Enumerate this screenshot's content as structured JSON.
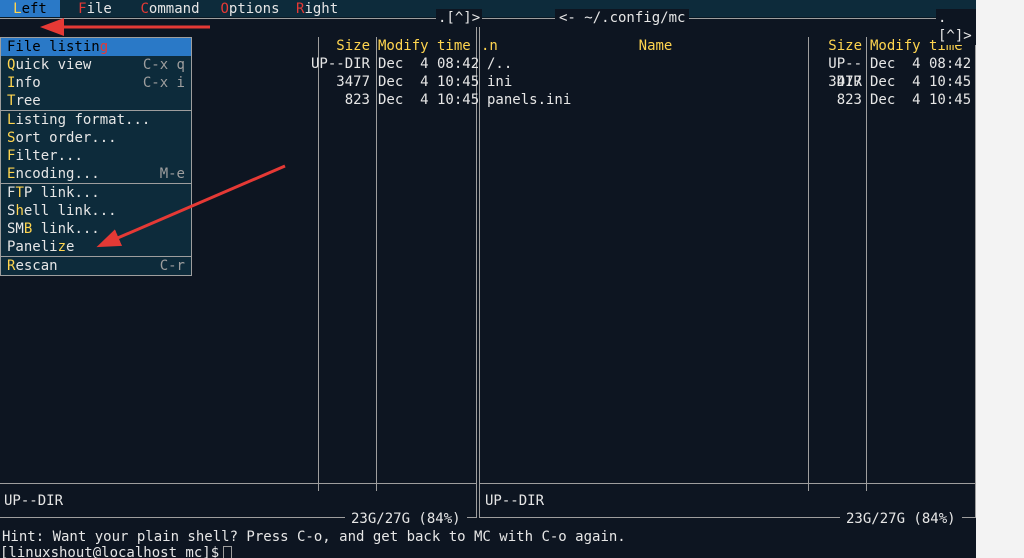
{
  "menubar": {
    "left": {
      "hot": "L",
      "rest": "eft"
    },
    "file": {
      "hot": "F",
      "rest": "ile"
    },
    "command": {
      "hot": "C",
      "rest": "ommand"
    },
    "options": {
      "hot": "O",
      "rest": "ptions"
    },
    "right": {
      "hot": "R",
      "rest": "ight"
    }
  },
  "dropdown": {
    "groups": [
      [
        {
          "label_pre": "File listin",
          "hot": "g",
          "label_post": "",
          "shortcut": "",
          "active": true
        },
        {
          "label_pre": "",
          "hot": "Q",
          "label_post": "uick view",
          "shortcut": "C-x q",
          "active": false
        },
        {
          "label_pre": "",
          "hot": "I",
          "label_post": "nfo",
          "shortcut": "C-x i",
          "active": false
        },
        {
          "label_pre": "",
          "hot": "T",
          "label_post": "ree",
          "shortcut": "",
          "active": false
        }
      ],
      [
        {
          "label_pre": "",
          "hot": "L",
          "label_post": "isting format...",
          "shortcut": "",
          "active": false
        },
        {
          "label_pre": "",
          "hot": "S",
          "label_post": "ort order...",
          "shortcut": "",
          "active": false
        },
        {
          "label_pre": "",
          "hot": "F",
          "label_post": "ilter...",
          "shortcut": "",
          "active": false
        },
        {
          "label_pre": "",
          "hot": "E",
          "label_post": "ncoding...",
          "shortcut": "M-e",
          "active": false
        }
      ],
      [
        {
          "label_pre": "F",
          "hot": "T",
          "label_post": "P link...",
          "shortcut": "",
          "active": false
        },
        {
          "label_pre": "S",
          "hot": "h",
          "label_post": "ell link...",
          "shortcut": "",
          "active": false
        },
        {
          "label_pre": "SM",
          "hot": "B",
          "label_post": " link...",
          "shortcut": "",
          "active": false
        },
        {
          "label_pre": "Paneli",
          "hot": "z",
          "label_post": "e",
          "shortcut": "",
          "active": false
        }
      ],
      [
        {
          "label_pre": "",
          "hot": "R",
          "label_post": "escan",
          "shortcut": "C-r",
          "active": false
        }
      ]
    ]
  },
  "panel_left": {
    "title": ".[^]>",
    "caret": ".[^]>",
    "headers": {
      "name": ".n",
      "size": "Size",
      "time": "Modify time"
    },
    "rows": [
      {
        "size": "UP--DIR",
        "time": "Dec  4 08:42"
      },
      {
        "size": "3477",
        "time": "Dec  4 10:45"
      },
      {
        "size": "823",
        "time": "Dec  4 10:45"
      }
    ],
    "selected": "UP--DIR",
    "disk": "23G/27G (84%)"
  },
  "panel_right": {
    "title": "<- ~/.config/mc",
    "caret": ".[^]>",
    "headers": {
      "name": "Name",
      "name_short": ".n",
      "size": "Size",
      "time": "Modify time"
    },
    "rows": [
      {
        "name": "/..",
        "size": "UP--DIR",
        "time": "Dec  4 08:42"
      },
      {
        "name": "ini",
        "size": "3477",
        "time": "Dec  4 10:45"
      },
      {
        "name": "panels.ini",
        "size": "823",
        "time": "Dec  4 10:45"
      }
    ],
    "selected": "UP--DIR",
    "disk": "23G/27G (84%)"
  },
  "bottom": {
    "hint": "Hint: Want your plain shell? Press C-o, and get back to MC with C-o again.",
    "prompt": "[linuxshout@localhost mc]$ "
  }
}
